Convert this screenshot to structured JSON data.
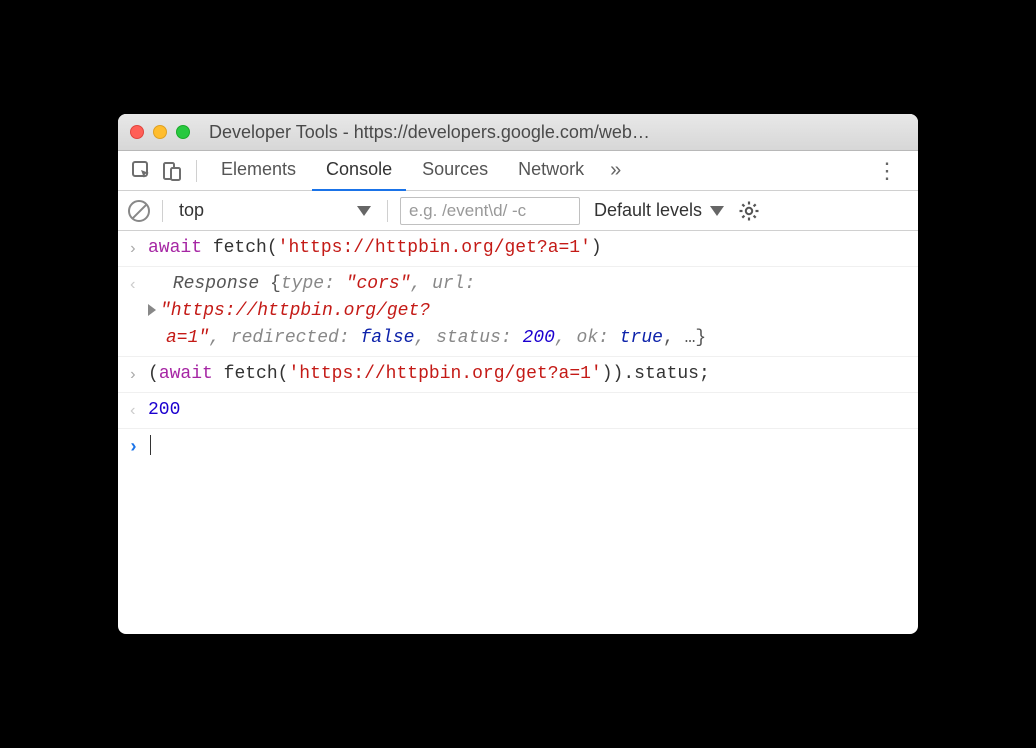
{
  "window": {
    "title": "Developer Tools - https://developers.google.com/web…"
  },
  "tabs": {
    "items": [
      "Elements",
      "Console",
      "Sources",
      "Network"
    ],
    "active_index": 1,
    "more_glyph": "»"
  },
  "toolbar": {
    "context": "top",
    "filter_placeholder": "e.g. /event\\d/ -c",
    "levels_label": "Default levels"
  },
  "console": {
    "entries": [
      {
        "type": "input",
        "parts": {
          "await": "await",
          "fetch": "fetch",
          "open": "(",
          "url": "'https://httpbin.org/get?a=1'",
          "close": ")"
        }
      },
      {
        "type": "output-object",
        "name": "Response",
        "open": "{",
        "close": ", …}",
        "props": {
          "type_key": "type:",
          "type_val": "\"cors\"",
          "url_key": ", url:",
          "url_val_line1": "\"https://httpbin.org/get?",
          "url_val_line2": "a=1\"",
          "redirected_key": ", redirected:",
          "redirected_val": "false",
          "status_key": ", status:",
          "status_val": "200",
          "ok_key": ", ok:",
          "ok_val": "true"
        }
      },
      {
        "type": "input",
        "parts": {
          "open_paren": "(",
          "await": "await",
          "fetch": "fetch",
          "open": "(",
          "url": "'https://httpbin.org/get?a=1'",
          "close": ")",
          "close_paren": ")",
          "dot_status": ".status;"
        }
      },
      {
        "type": "output-value",
        "value": "200"
      },
      {
        "type": "prompt"
      }
    ]
  }
}
